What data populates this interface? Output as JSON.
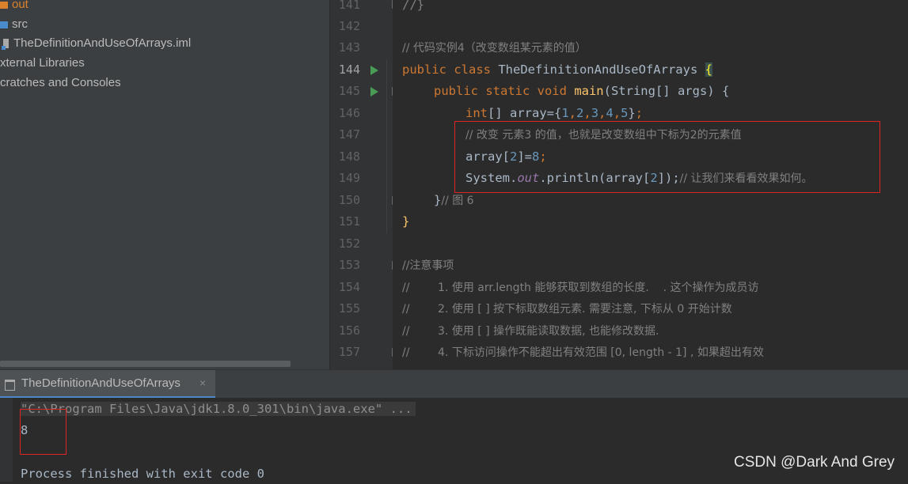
{
  "project": {
    "items": [
      {
        "label": "out",
        "icon": "folder-orange"
      },
      {
        "label": "src",
        "icon": "folder-blue"
      },
      {
        "label": "TheDefinitionAndUseOfArrays.iml",
        "icon": "iml-file"
      },
      {
        "label": "xternal Libraries",
        "icon": "none"
      },
      {
        "label": "cratches and Consoles",
        "icon": "none"
      }
    ]
  },
  "editor": {
    "line_numbers": [
      "141",
      "142",
      "143",
      "144",
      "145",
      "146",
      "147",
      "148",
      "149",
      "150",
      "151",
      "152",
      "153",
      "154",
      "155",
      "156",
      "157"
    ],
    "lines": {
      "l141": "//}",
      "l143": "// 代码实例4（改变数组某元素的值）",
      "l144_kw": "public class ",
      "l144_name": "TheDefinitionAndUseOfArrays ",
      "l144_brace": "{",
      "l145_kw": "public static void ",
      "l145_fn": "main",
      "l145_rest": "(String[] args) {",
      "l146_kw": "int",
      "l146_a": "[] array={",
      "l146_n1": "1",
      "l146_c1": ",",
      "l146_n2": "2",
      "l146_c2": ",",
      "l146_n3": "3",
      "l146_c3": ",",
      "l146_n4": "4",
      "l146_c4": ",",
      "l146_n5": "5",
      "l146_end1": "}",
      "l146_end2": ";",
      "l147": "// 改变 元素3 的值，也就是改变数组中下标为2的元素值",
      "l148_a": "array[",
      "l148_n": "2",
      "l148_b": "]=",
      "l148_v": "8",
      "l148_s": ";",
      "l149_a": "System.",
      "l149_out": "out",
      "l149_b": ".println(array[",
      "l149_n": "2",
      "l149_c": "]);",
      "l149_cm": "// 让我们来看看效果如何。",
      "l150_a": "}",
      "l150_cm": "// 图 6",
      "l151": "}",
      "l153": "//注意事项",
      "l154": "//        1. 使用 arr.length 能够获取到数组的长度.    . 这个操作为成员访",
      "l155": "//        2. 使用 [ ] 按下标取数组元素. 需要注意, 下标从 0 开始计数",
      "l156": "//        3. 使用 [ ] 操作既能读取数据, 也能修改数据.",
      "l157": "//        4. 下标访问操作不能超出有效范围 [0, length - 1] , 如果超出有效"
    }
  },
  "run": {
    "tab_label": "TheDefinitionAndUseOfArrays",
    "close": "×",
    "command": "\"C:\\Program Files\\Java\\jdk1.8.0_301\\bin\\java.exe\" ...",
    "output": "8",
    "exit": "Process finished with exit code 0"
  },
  "watermark": "CSDN @Dark And Grey",
  "colors": {
    "keyword": "#cc7832",
    "comment": "#808080",
    "number": "#6897bb",
    "function": "#ffc66d",
    "highlight_box": "#e02424"
  }
}
